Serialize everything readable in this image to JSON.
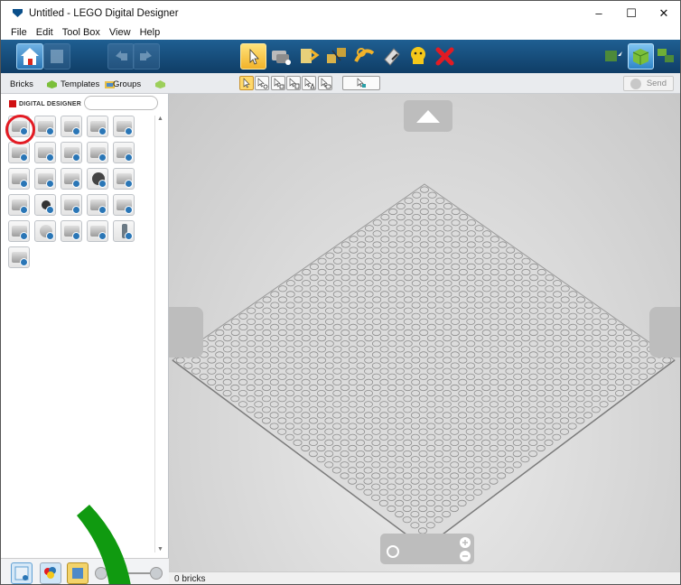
{
  "window": {
    "title": "Untitled - LEGO Digital Designer"
  },
  "menu": [
    "File",
    "Edit",
    "Tool Box",
    "View",
    "Help"
  ],
  "controls": {
    "minimize": "–",
    "maximize": "☐",
    "close": "✕"
  },
  "tabs": [
    {
      "label": "Bricks"
    },
    {
      "label": "Templates"
    },
    {
      "label": "Groups"
    }
  ],
  "palette": {
    "brand": "DIGITAL DESIGNER",
    "search_placeholder": "",
    "brick_rows": [
      5,
      5,
      5,
      5,
      5,
      1
    ]
  },
  "send": {
    "label": "Send"
  },
  "status": {
    "text": "0 bricks"
  },
  "colors": {
    "toolbar": "#1a5283",
    "accent_yellow": "#f2b32a",
    "highlight_red": "#e31b23",
    "arrow_green": "#109a10"
  },
  "icons": {
    "toolbar_left": [
      "home-icon",
      "save-icon",
      "undo-icon",
      "redo-icon"
    ],
    "toolbar_tools": [
      "select-icon",
      "clone-icon",
      "hinge-icon",
      "hinge-align-icon",
      "flex-icon",
      "paint-icon",
      "hide-icon",
      "delete-icon"
    ],
    "toolbar_right": [
      "build-mode-icon",
      "view-mode-icon",
      "instructions-mode-icon"
    ]
  }
}
